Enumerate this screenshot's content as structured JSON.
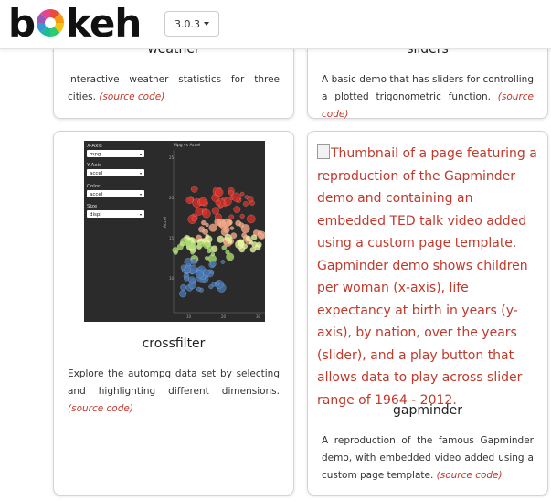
{
  "header": {
    "logo_text_left": "b",
    "logo_text_right": "keh",
    "version_label": "3.0.3"
  },
  "cards": {
    "weather": {
      "title": "weather",
      "description": "Interactive weather statistics for three cities.",
      "source_link": "(source code)"
    },
    "sliders": {
      "title": "sliders",
      "description": "A basic demo that has sliders for controlling a plotted trigonometric function.",
      "source_link": "(source code)"
    },
    "crossfilter": {
      "title": "crossfilter",
      "description": "Explore the autompg data set by selecting and highlighting different dimensions.",
      "source_link": "(source code)",
      "thumbnail": {
        "plot_title": "Mpg vs Accel",
        "y_axis_label": "Accel",
        "controls": [
          {
            "label": "X-Axis",
            "value": "mpg"
          },
          {
            "label": "Y-Axis",
            "value": "accel"
          },
          {
            "label": "Color",
            "value": "accel"
          },
          {
            "label": "Size",
            "value": "displ"
          }
        ],
        "y_ticks": [
          "25",
          "20",
          "15",
          "10"
        ],
        "x_ticks": [
          "10",
          "20",
          "30"
        ]
      }
    },
    "gapminder": {
      "title": "gapminder",
      "thumbnail_alt": "Thumbnail of a page featuring a reproduction of the Gapminder demo and containing an embedded TED talk video added using a custom page template. Gapminder demo shows children per woman (x-axis), life expectancy at birth in years (y-axis), by nation, over the years (slider), and a play button that allows data to play across slider range of 1964 - 2012.",
      "description": "A reproduction of the famous Gapminder demo, with embedded video added using a custom page template.",
      "source_link": "(source code)"
    }
  },
  "colors": {
    "link": "#c0392b",
    "logo_wheel": [
      "#e74c3c",
      "#f39c12",
      "#f1c40f",
      "#2ecc71",
      "#1abc9c",
      "#3498db",
      "#9b59b6",
      "#e84393"
    ]
  }
}
